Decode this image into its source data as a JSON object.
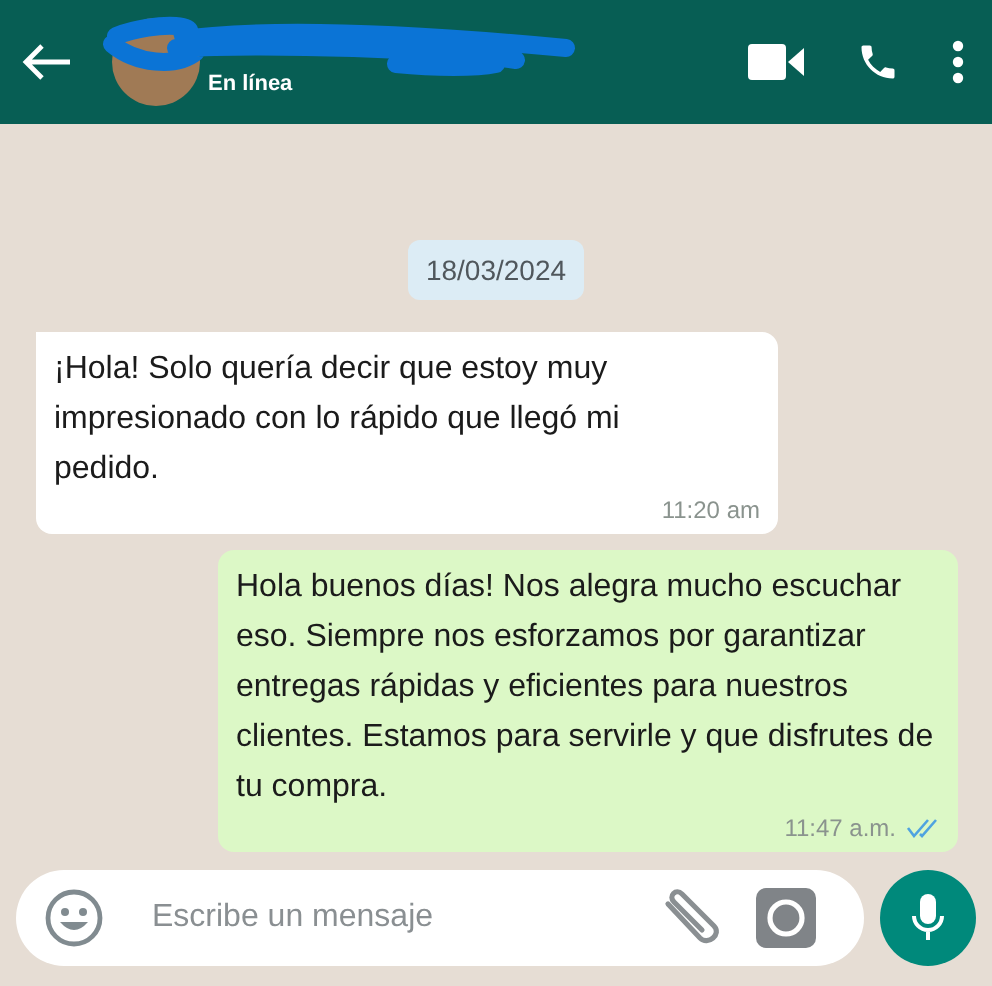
{
  "header": {
    "status": "En línea"
  },
  "date_chip": "18/03/2024",
  "messages": [
    {
      "kind": "incoming",
      "text": "¡Hola! Solo quería decir que estoy muy impresionado con lo rápido que llegó mi pedido.",
      "time": "11:20 am"
    },
    {
      "kind": "outgoing",
      "text": "Hola buenos días! Nos alegra mucho escuchar eso. Siempre nos esforzamos por garantizar entregas rápidas y eficientes para nuestros clientes. Estamos para servirle y que disfrutes de tu compra.",
      "time": "11:47 a.m.",
      "read": true
    }
  ],
  "composer": {
    "placeholder": "Escribe un mensaje"
  }
}
